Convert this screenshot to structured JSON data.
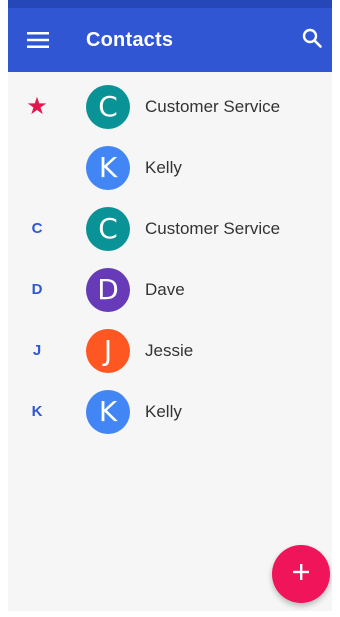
{
  "appbar": {
    "title": "Contacts",
    "menu_icon": "hamburger-menu-icon",
    "search_icon": "search-icon",
    "color": "#3056d3"
  },
  "contacts": [
    {
      "section": "★",
      "section_type": "favorite",
      "initial": "C",
      "name": "Customer Service",
      "avatar_color": "#0a9396"
    },
    {
      "section": "",
      "section_type": "favorite",
      "initial": "K",
      "name": "Kelly",
      "avatar_color": "#4285f4"
    },
    {
      "section": "C",
      "section_type": "letter",
      "initial": "C",
      "name": "Customer Service",
      "avatar_color": "#0a9396"
    },
    {
      "section": "D",
      "section_type": "letter",
      "initial": "D",
      "name": "Dave",
      "avatar_color": "#673ab7"
    },
    {
      "section": "J",
      "section_type": "letter",
      "initial": "J",
      "name": "Jessie",
      "avatar_color": "#ff5722"
    },
    {
      "section": "K",
      "section_type": "letter",
      "initial": "K",
      "name": "Kelly",
      "avatar_color": "#4285f4"
    }
  ],
  "fab": {
    "icon": "plus-icon",
    "color": "#f0145a"
  }
}
